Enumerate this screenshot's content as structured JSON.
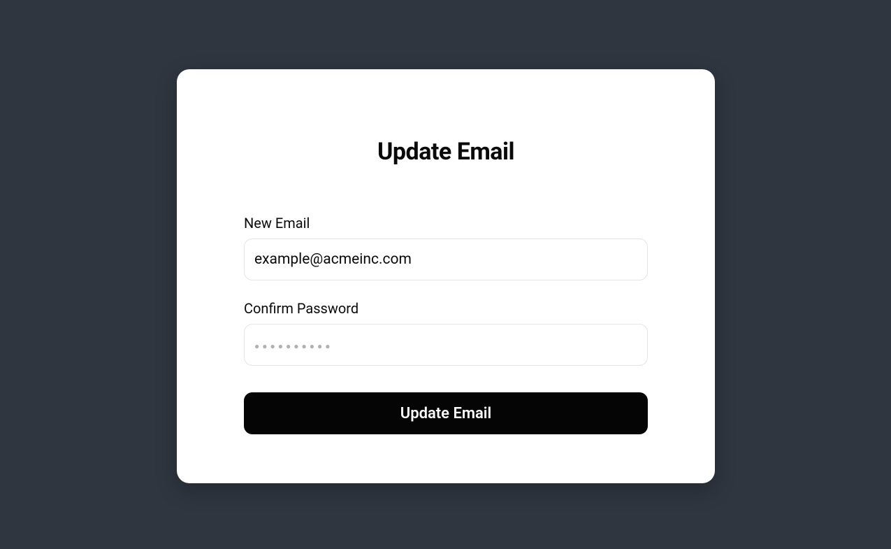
{
  "card": {
    "title": "Update Email",
    "fields": {
      "new_email": {
        "label": "New Email",
        "value": "example@acmeinc.com",
        "placeholder": ""
      },
      "confirm_password": {
        "label": "Confirm Password",
        "value": "",
        "placeholder": "●●●●●●●●●●"
      }
    },
    "submit_label": "Update Email"
  }
}
